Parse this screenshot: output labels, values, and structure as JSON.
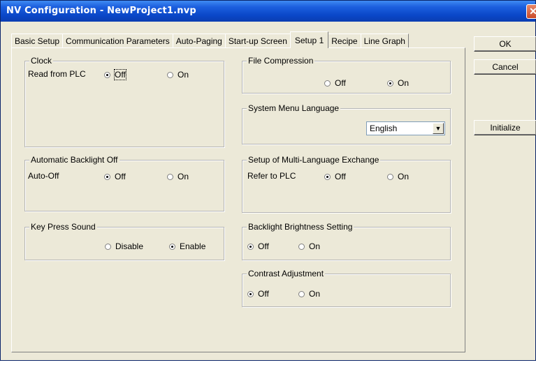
{
  "window": {
    "title": "NV Configuration - NewProject1.nvp",
    "close_glyph": "✕"
  },
  "tabs": [
    {
      "label": "Basic Setup"
    },
    {
      "label": "Communication Parameters"
    },
    {
      "label": "Auto-Paging"
    },
    {
      "label": "Start-up Screen"
    },
    {
      "label": "Setup 1",
      "active": true
    },
    {
      "label": "Recipe"
    },
    {
      "label": "Line Graph"
    }
  ],
  "clock": {
    "legend": "Clock",
    "label": "Read from PLC",
    "opt_off": "Off",
    "opt_on": "On",
    "selected": "Off"
  },
  "backlight_off": {
    "legend": "Automatic Backlight Off",
    "label": "Auto-Off",
    "opt_off": "Off",
    "opt_on": "On",
    "selected": "Off"
  },
  "key_press": {
    "legend": "Key Press Sound",
    "opt_disable": "Disable",
    "opt_enable": "Enable",
    "selected": "Enable"
  },
  "file_compression": {
    "legend": "File Compression",
    "opt_off": "Off",
    "opt_on": "On",
    "selected": "On"
  },
  "system_menu": {
    "legend": "System Menu Language",
    "value": "English"
  },
  "multi_language": {
    "legend": "Setup of Multi-Language Exchange",
    "label": "Refer to PLC",
    "opt_off": "Off",
    "opt_on": "On",
    "selected": "Off"
  },
  "brightness": {
    "legend": "Backlight Brightness Setting",
    "opt_off": "Off",
    "opt_on": "On",
    "selected": "Off"
  },
  "contrast": {
    "legend": "Contrast Adjustment",
    "opt_off": "Off",
    "opt_on": "On",
    "selected": "Off"
  },
  "buttons": {
    "ok": "OK",
    "cancel": "Cancel",
    "initialize": "Initialize"
  }
}
